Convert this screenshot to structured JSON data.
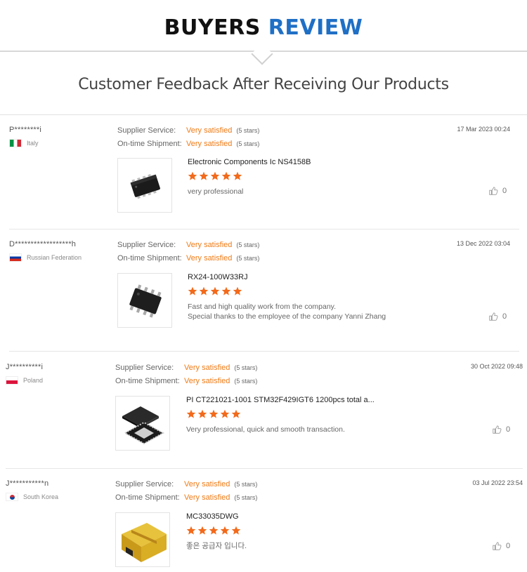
{
  "header": {
    "title_main": "BUYERS",
    "title_accent": "REVIEW"
  },
  "subtitle": "Customer Feedback After Receiving Our Products",
  "labels": {
    "supplier_service": "Supplier Service:",
    "ontime_shipment": "On-time Shipment:"
  },
  "colors": {
    "accent_blue": "#1f6fc5",
    "rating_orange": "#f07b15",
    "star_orange": "#f26a1b"
  },
  "reviews": [
    {
      "buyer": "P********i",
      "country": "Italy",
      "flag_icon": "italy-flag-icon",
      "date": "17 Mar 2023 00:24",
      "supplier_service": "Very satisfied",
      "supplier_stars": "(5 stars)",
      "ontime_shipment": "Very satisfied",
      "ontime_stars": "(5 stars)",
      "product": "Electronic Components Ic NS4158B",
      "rating": 5,
      "comment_line1": "very professional",
      "comment_line2": "",
      "likes": "0",
      "thumb_icon": "dfn-chip-icon"
    },
    {
      "buyer": "D******************h",
      "country": "Russian Federation",
      "flag_icon": "russia-flag-icon",
      "date": "13 Dec 2022 03:04",
      "supplier_service": "Very satisfied",
      "supplier_stars": "(5 stars)",
      "ontime_shipment": "Very satisfied",
      "ontime_stars": "(5 stars)",
      "product": "RX24-100W33RJ",
      "rating": 5,
      "comment_line1": "Fast and high quality work from the company.",
      "comment_line2": "Special thanks to the employee of the company Yanni Zhang",
      "likes": "0",
      "thumb_icon": "soic-chip-icon"
    },
    {
      "buyer": "J**********i",
      "country": "Poland",
      "flag_icon": "poland-flag-icon",
      "date": "30 Oct 2022 09:48",
      "supplier_service": "Very satisfied",
      "supplier_stars": "(5 stars)",
      "ontime_shipment": "Very satisfied",
      "ontime_stars": "(5 stars)",
      "product": "PI CT221021-1001 STM32F429IGT6 1200pcs total a...",
      "rating": 5,
      "comment_line1": "Very professional, quick and smooth transaction.",
      "comment_line2": "",
      "likes": "0",
      "thumb_icon": "qfn-chip-icon"
    },
    {
      "buyer": "J***********n",
      "country": "South Korea",
      "flag_icon": "korea-flag-icon",
      "date": "03 Jul 2022 23:54",
      "supplier_service": "Very satisfied",
      "supplier_stars": "(5 stars)",
      "ontime_shipment": "Very satisfied",
      "ontime_stars": "(5 stars)",
      "product": "MC33035DWG",
      "rating": 5,
      "comment_line1": "좋은 공급자 입니다.",
      "comment_line2": "",
      "likes": "0",
      "thumb_icon": "shipping-box-icon"
    }
  ]
}
